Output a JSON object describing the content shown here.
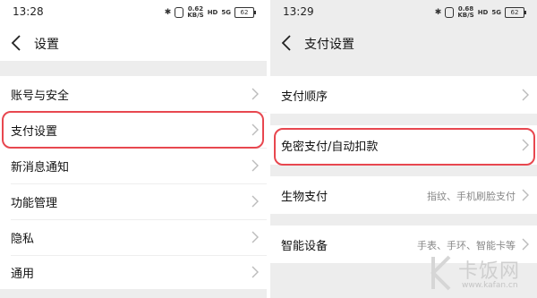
{
  "left": {
    "status": {
      "time": "13:28",
      "speed_top": "0.62",
      "speed_unit": "KB/S",
      "batt": "62",
      "net1": "HD",
      "net2": "5G"
    },
    "title": "设置",
    "items": [
      "账号与安全",
      "支付设置",
      "新消息通知",
      "功能管理",
      "隐私",
      "通用"
    ]
  },
  "right": {
    "status": {
      "time": "13:29",
      "speed_top": "0.68",
      "speed_unit": "KB/S",
      "batt": "62",
      "net1": "HD",
      "net2": "5G"
    },
    "title": "支付设置",
    "items": [
      {
        "label": "支付顺序",
        "sub": ""
      },
      {
        "label": "免密支付/自动扣款",
        "sub": ""
      },
      {
        "label": "生物支付",
        "sub": "指纹、手机刷脸支付"
      },
      {
        "label": "智能设备",
        "sub": "手表、手环、智能卡等"
      }
    ]
  },
  "watermark": {
    "text": "卡饭网",
    "url": "www.kafan.cn"
  },
  "colors": {
    "highlight": "#e8474f",
    "background": "#ededed"
  }
}
